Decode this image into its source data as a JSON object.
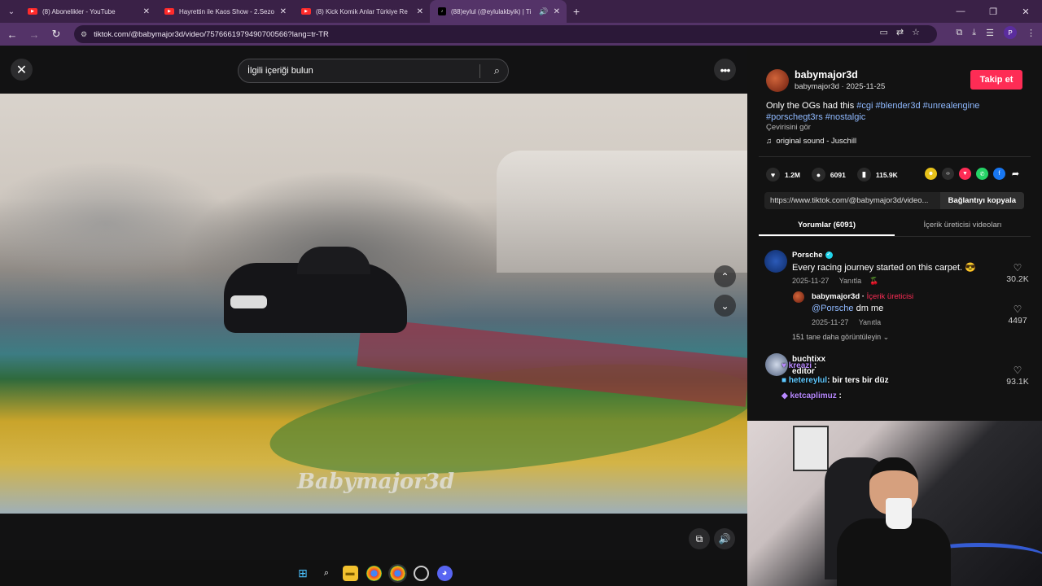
{
  "browser": {
    "tabs": [
      {
        "title": "(8) Abonelikler - YouTube",
        "icon": "youtube-icon",
        "active": false
      },
      {
        "title": "Hayrettin ile Kaos Show - 2.Sezo",
        "icon": "youtube-icon",
        "active": false
      },
      {
        "title": "(8) Kick Komik Anlar Türkiye Re",
        "icon": "youtube-icon",
        "active": false
      },
      {
        "title": "(88)eylul (@eylulakbyik) | Ti",
        "icon": "tiktok-icon",
        "active": true
      }
    ],
    "url": "tiktok.com/@babymajor3d/video/7576661979490700566?lang=tr-TR",
    "profile_initial": "P"
  },
  "video": {
    "search_placeholder": "İlgili içeriği bulun",
    "watermark": "Babymajor3d"
  },
  "post": {
    "username": "babymajor3d",
    "handle_date": "babymajor3d · 2025-11-25",
    "follow_label": "Takip et",
    "desc_text": "Only the OGs had this ",
    "hashtags_line1": "#cgi #blender3d #unrealengine",
    "hashtags_line2": "#porschegt3rs #nostalgic",
    "see_translation": "Çevirisini gör",
    "sound": "original sound - Juschill",
    "likes": "1.2M",
    "comments": "6091",
    "saves": "115.9K",
    "link": "https://www.tiktok.com/@babymajor3d/video...",
    "copy_link": "Bağlantıyı kopyala",
    "tab_comments": "Yorumlar (6091)",
    "tab_creator_videos": "İçerik üreticisi videoları"
  },
  "comments": [
    {
      "name": "Porsche",
      "text": "Every racing journey started on this carpet. 😎",
      "date": "2025-11-27",
      "reply": "Yanıtla",
      "likes": "30.2K"
    },
    {
      "name": "babymajor3d",
      "badge": "İçerik üreticisi",
      "mention": "@Porsche",
      "text": " dm me",
      "date": "2025-11-27",
      "reply": "Yanıtla",
      "likes": "4497"
    }
  ],
  "more_replies": "151 tane daha görüntüleyin",
  "third_like": "93.1K",
  "chat": [
    {
      "user": "buchtixx",
      "msg": ""
    },
    {
      "user": "kreazi",
      "msg": " : "
    },
    {
      "user": "editor",
      "msg": ""
    },
    {
      "user": "hetereylul",
      "msg": ": bir ters bir düz"
    },
    {
      "user": "ketcaplimuz",
      "msg": " : "
    }
  ],
  "colors": {
    "accent": "#fe2c55",
    "hashtag": "#8fb9ff",
    "browser_frame": "#543368"
  }
}
